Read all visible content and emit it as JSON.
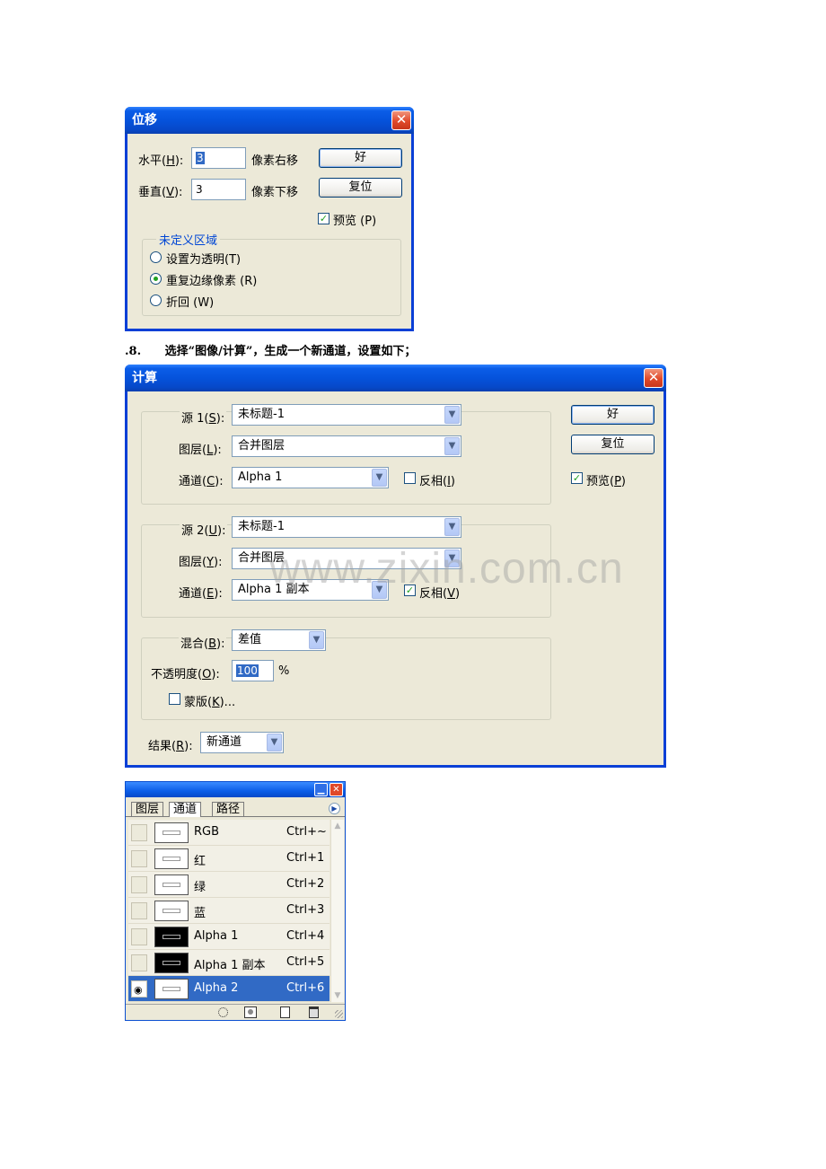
{
  "offset_dialog": {
    "title": "位移",
    "close_glyph": "✕",
    "horizontal": {
      "label_pre": "水平(",
      "key": "H",
      "label_post": "):",
      "value": "3",
      "unit": "像素右移"
    },
    "vertical": {
      "label_pre": "垂直(",
      "key": "V",
      "label_post": "):",
      "value": "3",
      "unit": "像素下移"
    },
    "ok_label": "好",
    "reset_label": "复位",
    "preview": {
      "checked": true,
      "label": "预览",
      "key_text": "(P)"
    },
    "undefined_area": {
      "title": "未定义区域",
      "options": [
        {
          "label": "设置为透明",
          "key_text": "(T)",
          "selected": false
        },
        {
          "label": "重复边缘像素",
          "key_text": "(R)",
          "selected": true
        },
        {
          "label": "折回",
          "key_text": "(W)",
          "selected": false
        }
      ]
    }
  },
  "step_caption": {
    "number": ".8.",
    "text": "选择“图像/计算”，生成一个新通道，设置如下；"
  },
  "calc_dialog": {
    "title": "计算",
    "close_glyph": "✕",
    "source1": {
      "source_label_pre": "源 1(",
      "source_key": "S",
      "source_value": "未标题-1",
      "layer_label_pre": "图层(",
      "layer_key": "L",
      "layer_value": "合并图层",
      "channel_label_pre": "通道(",
      "channel_key": "C",
      "channel_value": "Alpha 1",
      "invert_label": "反相(",
      "invert_key": "I",
      "invert_checked": false
    },
    "source2": {
      "source_label_pre": "源 2(",
      "source_key": "U",
      "source_value": "未标题-1",
      "layer_label_pre": "图层(",
      "layer_key": "Y",
      "layer_value": "合并图层",
      "channel_label_pre": "通道(",
      "channel_key": "E",
      "channel_value": "Alpha 1 副本",
      "invert_label": "反相(",
      "invert_key": "V",
      "invert_checked": true
    },
    "blend": {
      "label_pre": "混合(",
      "key": "B",
      "value": "差值",
      "opacity_label_pre": "不透明度(",
      "opacity_key": "O",
      "opacity_value": "100",
      "opacity_unit": "%",
      "mask_label_pre": "蒙版(",
      "mask_key": "K",
      "mask_label_post": ")...",
      "mask_checked": false
    },
    "result": {
      "label_pre": "结果(",
      "key": "R",
      "value": "新通道"
    },
    "ok_label": "好",
    "reset_label": "复位",
    "preview": {
      "checked": true,
      "label": "预览(",
      "key": "P"
    },
    "closing_paren": "):"
  },
  "channels_palette": {
    "tabs": [
      "图层",
      "通道",
      "路径"
    ],
    "active_tab": "通道",
    "channels": [
      {
        "name": "RGB",
        "shortcut": "Ctrl+~",
        "thumb": "light",
        "visible": false,
        "selected": false
      },
      {
        "name": "红",
        "shortcut": "Ctrl+1",
        "thumb": "light",
        "visible": false,
        "selected": false
      },
      {
        "name": "绿",
        "shortcut": "Ctrl+2",
        "thumb": "light",
        "visible": false,
        "selected": false
      },
      {
        "name": "蓝",
        "shortcut": "Ctrl+3",
        "thumb": "light",
        "visible": false,
        "selected": false
      },
      {
        "name": "Alpha 1",
        "shortcut": "Ctrl+4",
        "thumb": "dark",
        "visible": false,
        "selected": false
      },
      {
        "name": "Alpha 1 副本",
        "shortcut": "Ctrl+5",
        "thumb": "dark",
        "visible": false,
        "selected": false
      },
      {
        "name": "Alpha 2",
        "shortcut": "Ctrl+6",
        "thumb": "light",
        "visible": true,
        "selected": true
      }
    ]
  },
  "watermark": "www.zixin.com.cn",
  "colors": {
    "title_blue": "#0553dc",
    "dialog_bg": "#ece9d8",
    "selection": "#316ac5",
    "close_red": "#e0492a"
  }
}
